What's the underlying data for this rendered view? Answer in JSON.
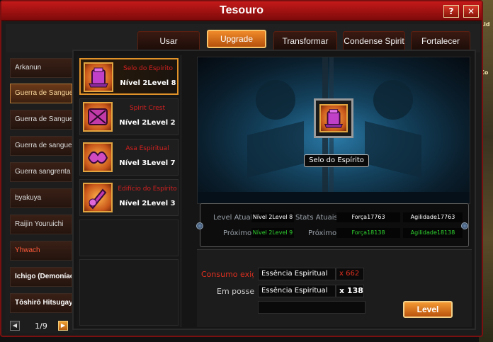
{
  "window": {
    "title": "Tesouro",
    "help_label": "?",
    "close_label": "✕"
  },
  "tabs": [
    {
      "label": "Usar",
      "active": false
    },
    {
      "label": "Upgrade",
      "active": true
    },
    {
      "label": "Transformar",
      "active": false
    },
    {
      "label": "Condense Spirit",
      "active": false
    },
    {
      "label": "Fortalecer",
      "active": false
    }
  ],
  "sidebar": {
    "items": [
      {
        "label": "Arkanun",
        "style": "normal"
      },
      {
        "label": "Guerra de Sangue",
        "style": "selected"
      },
      {
        "label": "Guerra de Sangue",
        "style": "normal"
      },
      {
        "label": "Guerra de sangue",
        "style": "normal"
      },
      {
        "label": "Guerra sangrenta",
        "style": "normal"
      },
      {
        "label": "byakuya",
        "style": "normal"
      },
      {
        "label": "Raijin Youruichi",
        "style": "normal"
      },
      {
        "label": "Yhwach",
        "style": "red"
      },
      {
        "label": "Ichigo (Demoníaco)",
        "style": "white"
      },
      {
        "label": "Tōshirō Hitsugaya",
        "style": "white"
      }
    ],
    "pager": {
      "text": "1/9",
      "prev": "◀",
      "next": "▶"
    }
  },
  "treasures": [
    {
      "name": "Selo do Espírito",
      "level": "Nível 2Level 8",
      "icon": "spirit-seal-icon",
      "selected": true
    },
    {
      "name": "Spirit Crest",
      "level": "Nível 2Level 2",
      "icon": "spirit-crest-icon",
      "selected": false
    },
    {
      "name": "Asa Espiritual",
      "level": "Nível 3Level 7",
      "icon": "spirit-wing-icon",
      "selected": false
    },
    {
      "name": "Edifício do Espírito",
      "level": "Nível 2Level 3",
      "icon": "spirit-edifice-icon",
      "selected": false
    }
  ],
  "preview": {
    "name": "Selo do Espírito",
    "icon": "spirit-seal-icon"
  },
  "stats": {
    "level_label": "Level Atual",
    "level_value": "Nível 2Level 8",
    "stats_label": "Stats Atuais",
    "force_value": "Força17763",
    "agility_value": "Agilidade17763",
    "next_label": "Próximo",
    "next_level_value": "Nível 2Level 9",
    "next_stats_label": "Próximo",
    "next_force_value": "Força18138",
    "next_agility_value": "Agilidade18138"
  },
  "cost": {
    "consumo_label": "Consumo exigido",
    "consumo_item": "Essência Espiritual",
    "consumo_qty": "x 662",
    "posse_label": "Em posse",
    "posse_item": "Essência Espiritual",
    "posse_qty": "x 138"
  },
  "action": {
    "level_label": "Level"
  },
  "edge": {
    "top_text": "Lid",
    "mid_text": "Co"
  },
  "colors": {
    "accent": "#e1932a",
    "title_bar": "#c51a1a",
    "next_green": "#2fd22f",
    "cost_red": "#e03020"
  }
}
